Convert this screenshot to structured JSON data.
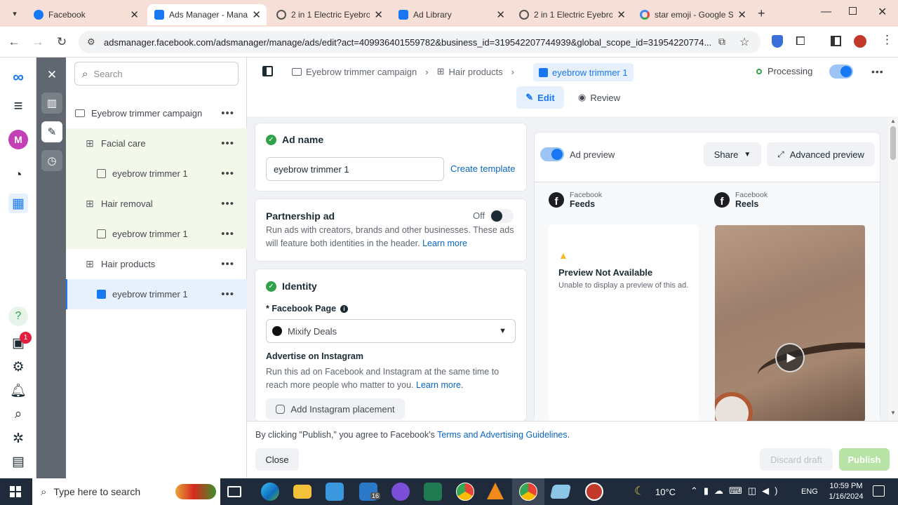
{
  "browser": {
    "tabs": [
      {
        "title": "Facebook",
        "color": "#1877f2"
      },
      {
        "title": "Ads Manager - Mana",
        "color": "#1877f2"
      },
      {
        "title": "2 in 1 Electric Eyebro",
        "color": "#555"
      },
      {
        "title": "Ad Library",
        "color": "#1877f2"
      },
      {
        "title": "2 in 1 Electric Eyebro",
        "color": "#555"
      },
      {
        "title": "star emoji - Google S",
        "color": "#4285f4"
      }
    ],
    "url": "adsmanager.facebook.com/adsmanager/manage/ads/edit?act=409936401559782&business_id=319542207744939&global_scope_id=31954220774..."
  },
  "rail": {
    "avatar_letter": "M",
    "notification_count": "1"
  },
  "tree": {
    "search_placeholder": "Search",
    "items": [
      {
        "label": "Eyebrow trimmer campaign",
        "level": "campaign"
      },
      {
        "label": "Facial care",
        "level": "adset"
      },
      {
        "label": "eyebrow trimmer 1",
        "level": "ad"
      },
      {
        "label": "Hair removal",
        "level": "adset"
      },
      {
        "label": "eyebrow trimmer 1",
        "level": "ad"
      },
      {
        "label": "Hair products",
        "level": "adset"
      },
      {
        "label": "eyebrow trimmer 1",
        "level": "ad"
      }
    ]
  },
  "topbar": {
    "breadcrumb": [
      "Eyebrow trimmer campaign",
      "Hair products",
      "eyebrow trimmer 1"
    ],
    "status": "Processing",
    "edit_label": "Edit",
    "review_label": "Review"
  },
  "ad_name": {
    "heading": "Ad name",
    "value": "eyebrow trimmer 1",
    "create_template": "Create template"
  },
  "partnership": {
    "heading": "Partnership ad",
    "toggle_label": "Off",
    "text": "Run ads with creators, brands and other businesses. These ads will feature both identities in the header.",
    "learn_more": "Learn more"
  },
  "identity": {
    "heading": "Identity",
    "page_label": "* Facebook Page",
    "page_value": "Mixify Deals",
    "instagram_heading": "Advertise on Instagram",
    "instagram_text": "Run this ad on Facebook and Instagram at the same time to reach more people who matter to you.",
    "learn_more": "Learn more.",
    "add_instagram": "Add Instagram placement"
  },
  "preview": {
    "label": "Ad preview",
    "share": "Share",
    "advanced": "Advanced preview",
    "feeds_platform": "Facebook",
    "feeds_label": "Feeds",
    "reels_platform": "Facebook",
    "reels_label": "Reels",
    "na_title": "Preview Not Available",
    "na_text": "Unable to display a preview of this ad."
  },
  "footer": {
    "terms_prefix": "By clicking \"Publish,\" you agree to Facebook's",
    "terms_link": "Terms and Advertising Guidelines",
    "terms_suffix": ".",
    "close": "Close",
    "discard": "Discard draft",
    "publish": "Publish"
  },
  "taskbar": {
    "search_placeholder": "Type here to search",
    "weather": "10°C",
    "lang": "ENG",
    "time": "10:59 PM",
    "date": "1/16/2024",
    "mail_badge": "16"
  },
  "colors": {
    "accent": "#1877f2",
    "link": "#0a66c2",
    "green": "#31a24c",
    "rail_dark": "#606770",
    "publish": "#b7e4a6"
  }
}
